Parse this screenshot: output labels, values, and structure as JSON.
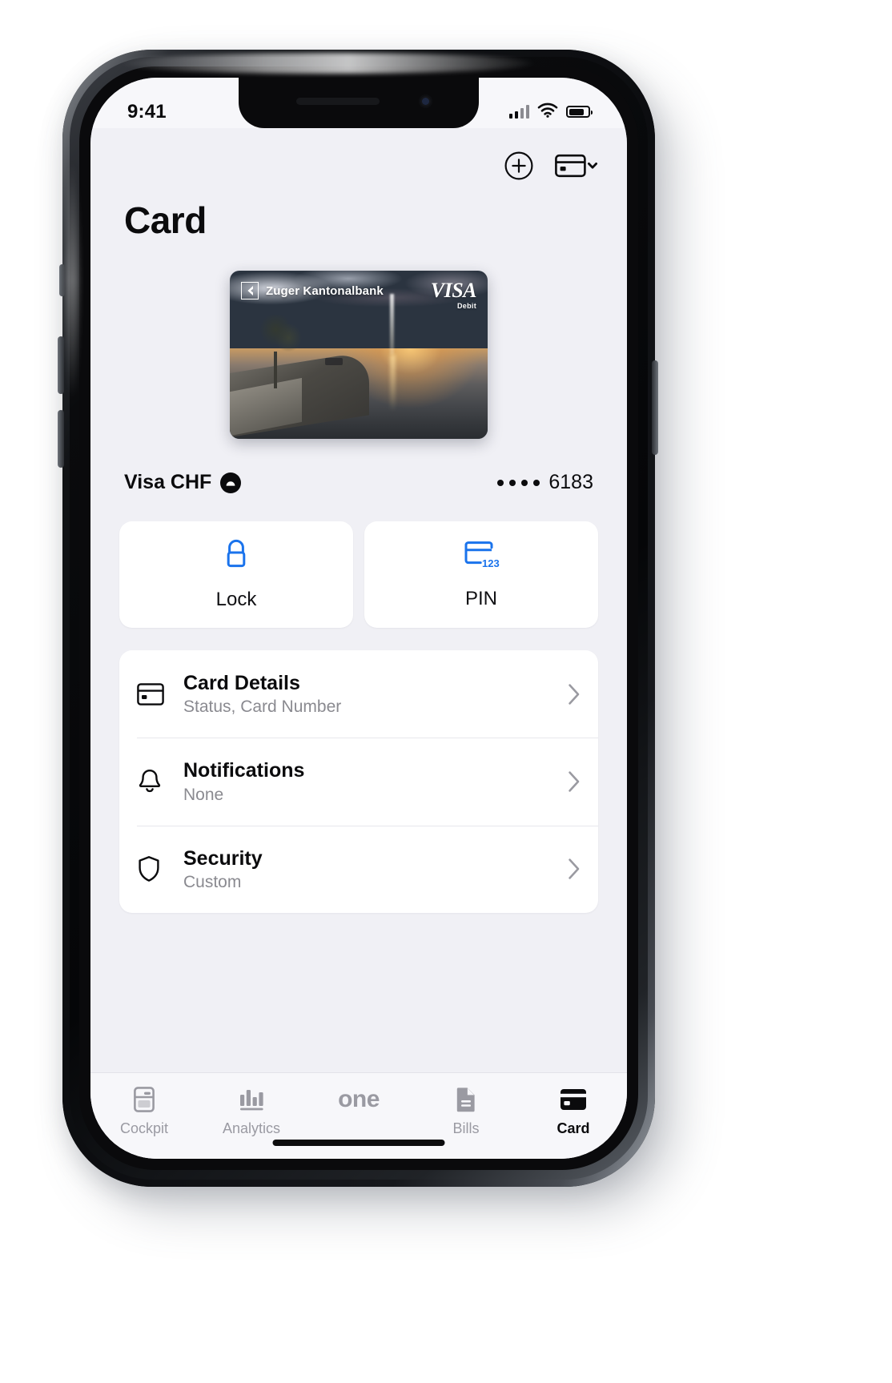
{
  "status_bar": {
    "time": "9:41",
    "signal_icon": "cellular-signal-icon",
    "wifi_icon": "wifi-icon",
    "battery_icon": "battery-icon"
  },
  "header": {
    "title": "Card",
    "add_icon": "plus-circle-icon",
    "card_switch_icon": "card-chevron-down-icon"
  },
  "card": {
    "bank_name": "Zuger Kantonalbank",
    "bank_logo_icon": "zuger-kantonalbank-logo-icon",
    "network_brand": "VISA",
    "network_type": "Debit",
    "artwork_description": "Lakeside sunset with fountain jet and tree"
  },
  "card_summary": {
    "name": "Visa CHF",
    "cloud_icon": "cloud-badge-icon",
    "masked_prefix": "• • • •",
    "last_four": "6183"
  },
  "quick_actions": [
    {
      "label": "Lock",
      "icon": "lock-icon",
      "color": "#1a73ec"
    },
    {
      "label": "PIN",
      "icon": "card-pin-123-icon",
      "color": "#1a73ec"
    }
  ],
  "settings_rows": [
    {
      "title": "Card Details",
      "subtitle": "Status, Card Number",
      "icon": "credit-card-icon",
      "chevron": "chevron-right-icon"
    },
    {
      "title": "Notifications",
      "subtitle": "None",
      "icon": "bell-icon",
      "chevron": "chevron-right-icon"
    },
    {
      "title": "Security",
      "subtitle": "Custom",
      "icon": "shield-icon",
      "chevron": "chevron-right-icon"
    }
  ],
  "tabbar": [
    {
      "label": "Cockpit",
      "icon": "cockpit-icon",
      "active": false
    },
    {
      "label": "Analytics",
      "icon": "bar-chart-icon",
      "active": false
    },
    {
      "label": "one",
      "icon": "one-wordmark",
      "active": false
    },
    {
      "label": "Bills",
      "icon": "document-icon",
      "active": false
    },
    {
      "label": "Card",
      "icon": "card-icon",
      "active": true
    }
  ],
  "colors": {
    "accent": "#1a73ec",
    "screen_bg": "#f0f0f5",
    "surface": "#ffffff",
    "text_primary": "#0b0b0d",
    "text_secondary": "#8a8a90",
    "tab_inactive": "#9a9aa2"
  }
}
